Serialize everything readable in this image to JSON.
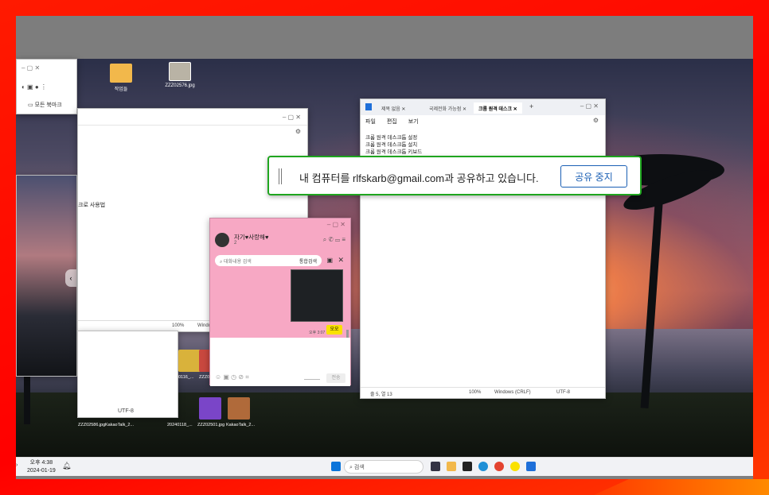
{
  "share_banner": {
    "message": "내 컴퓨터를 rlfskarb@gmail.com과 공유하고 있습니다.",
    "stop_button": "공유 중지"
  },
  "desktop_icons": [
    {
      "label": "작업들"
    },
    {
      "label": "ZZZ02576.jpg"
    }
  ],
  "browser_window": {
    "bookmark_label": "모든 북마크"
  },
  "notepad_left": {
    "partial_text": "크로 사용법",
    "status_zoom": "100%",
    "status_line": "Windo",
    "encoding": "UTF-8"
  },
  "kakao_chat": {
    "chat_name": "자기♥사랑해♥",
    "member_count": "2",
    "search_placeholder": "대화내용 검색",
    "search_all": "통합검색",
    "time": "오후 3:07",
    "badge": "오오",
    "send_button": "전송"
  },
  "notepad_right": {
    "tabs": [
      "제목 없음",
      "국제전화 가능점",
      "크롬 원격 데스크"
    ],
    "menu": [
      "파일",
      "편집",
      "보기"
    ],
    "lines": [
      "크롬 원격 데스크톱 설정",
      "크롬 원격 데스크톱 설치",
      "크롬 원격 데스크톱 키보드"
    ],
    "status_pos": "줄 5, 열 13",
    "status_zoom": "100%",
    "status_eol": "Windows (CRLF)",
    "status_enc": "UTF-8"
  },
  "file_thumbs": [
    {
      "label": "ZZZ02586.jpg"
    },
    {
      "label": "KakaoTalk_2..."
    },
    {
      "label": "20240118_..."
    },
    {
      "label": "ZZZ02501.jpg"
    },
    {
      "label": "KakaoTalk_2..."
    }
  ],
  "thumb_row_labels": [
    "0116_...",
    "ZZZ0"
  ],
  "taskbar": {
    "search_placeholder": "검색",
    "time": "오후 4:38",
    "date": "2024-01-19"
  },
  "colors": {
    "frame": "#ff0000",
    "share_border": "#1fa51f",
    "share_button": "#1a5fb4"
  }
}
